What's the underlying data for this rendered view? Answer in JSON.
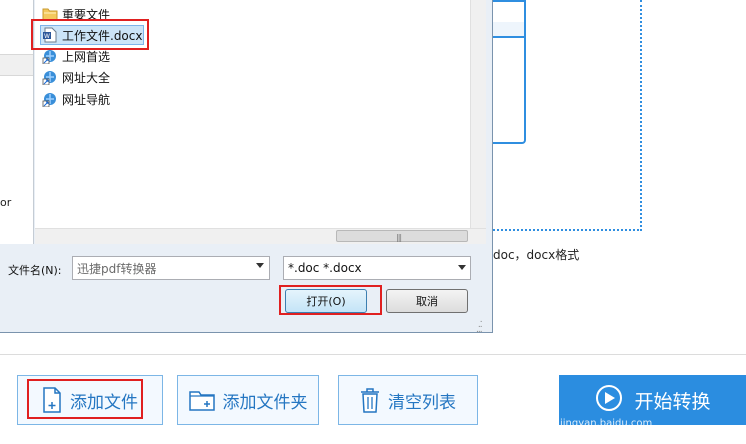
{
  "dialog": {
    "files": [
      {
        "name": "重要文件",
        "icon": "folder-icon"
      },
      {
        "name": "工作文件.docx",
        "icon": "word-doc-icon",
        "selected": true
      },
      {
        "name": "上网首选",
        "icon": "ie-shortcut-icon"
      },
      {
        "name": "网址大全",
        "icon": "ie-shortcut-icon"
      },
      {
        "name": "网址导航",
        "icon": "ie-shortcut-icon"
      }
    ],
    "left_pane_text": "or",
    "filename_label": "文件名(N):",
    "filename_value": "迅捷pdf转换器",
    "filetype_value": "*.doc *.docx",
    "open_label": "打开(O)",
    "cancel_label": "取消"
  },
  "app": {
    "format_hint": "doc，docx格式",
    "add_file_label": "添加文件",
    "add_folder_label": "添加文件夹",
    "clear_list_label": "清空列表",
    "convert_label": "开始转换",
    "watermark": "jingyan.baidu.com",
    "accent_color": "#2b8de0",
    "highlight_color": "#e02020"
  }
}
